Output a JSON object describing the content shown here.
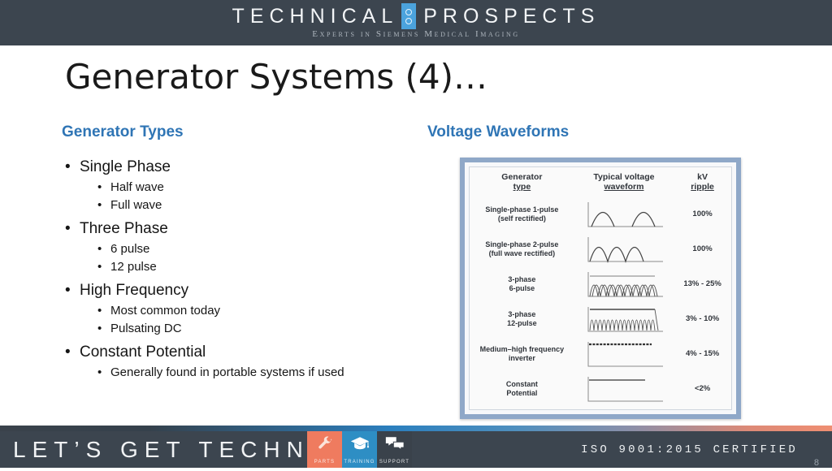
{
  "header": {
    "brand_left": "TECHNICAL",
    "brand_right": "PROSPECTS",
    "tagline": "Experts in Siemens Medical Imaging",
    "logo_icon": "two-circles-logo-icon",
    "bg_color": "#3c454f",
    "accent_color": "#4ba3dd"
  },
  "title": "Generator Systems (4)…",
  "left": {
    "heading": "Generator Types",
    "heading_color": "#2f75b5",
    "bullets": [
      {
        "text": "Single Phase",
        "sub": [
          "Half wave",
          "Full wave"
        ]
      },
      {
        "text": "Three Phase",
        "sub": [
          "6 pulse",
          "12 pulse"
        ]
      },
      {
        "text": "High Frequency",
        "sub": [
          "Most common today",
          "Pulsating DC"
        ]
      },
      {
        "text": "Constant Potential",
        "sub": [
          "Generally found in portable systems if used"
        ]
      }
    ]
  },
  "right": {
    "heading": "Voltage Waveforms",
    "heading_color": "#2f75b5",
    "figure": {
      "columns": [
        "Generator",
        "type",
        "Typical voltage",
        "waveform",
        "kV",
        "ripple"
      ],
      "col_type_line1": "Generator",
      "col_type_line2": "type",
      "col_wave_line1": "Typical voltage",
      "col_wave_line2": "waveform",
      "col_ripple_line1": "kV",
      "col_ripple_line2": "ripple",
      "rows": [
        {
          "type_line1": "Single-phase 1-pulse",
          "type_line2": "(self rectified)",
          "waveform": "half-wave-rectified",
          "ripple": "100%"
        },
        {
          "type_line1": "Single-phase 2-pulse",
          "type_line2": "(full wave rectified)",
          "waveform": "full-wave-rectified",
          "ripple": "100%"
        },
        {
          "type_line1": "3-phase",
          "type_line2": "6-pulse",
          "waveform": "three-phase-6-pulse",
          "ripple": "13% - 25%"
        },
        {
          "type_line1": "3-phase",
          "type_line2": "12-pulse",
          "waveform": "three-phase-12-pulse",
          "ripple": "3% - 10%"
        },
        {
          "type_line1": "Medium–high frequency",
          "type_line2": "inverter",
          "waveform": "medium-high-frequency",
          "ripple": "4% - 15%"
        },
        {
          "type_line1": "Constant",
          "type_line2": "Potential",
          "waveform": "constant-potential",
          "ripple": "<2%"
        }
      ]
    }
  },
  "footer": {
    "tagline": "LET’S GET TECHNICAL",
    "tiles": [
      {
        "label": "PARTS",
        "icon": "wrench-icon",
        "color": "#ef7b5f"
      },
      {
        "label": "TRAINING",
        "icon": "graduation-cap-icon",
        "color": "#2e8ec4"
      },
      {
        "label": "SUPPORT",
        "icon": "chat-bubbles-icon",
        "color": "#3a424b"
      }
    ],
    "certification": "ISO 9001:2015 CERTIFIED",
    "page_number": "8"
  }
}
